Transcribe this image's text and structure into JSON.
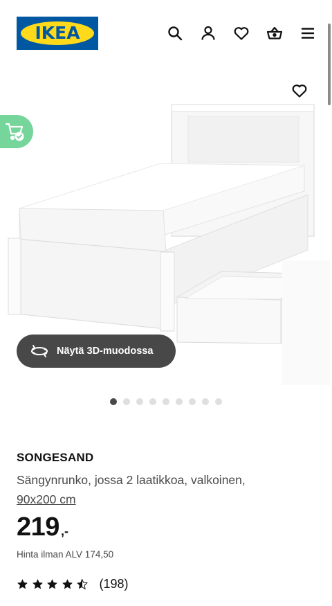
{
  "header": {
    "logo_text": "IKEA",
    "icons": [
      "search-icon",
      "user-icon",
      "heart-icon",
      "basket-icon",
      "menu-icon"
    ]
  },
  "gallery": {
    "view3d_label": "Näytä 3D-muodossa",
    "slide_count": 9,
    "active_slide": 1
  },
  "product": {
    "brand": "SONGESAND",
    "description": "Sängynrunko, jossa 2 laatikkoa, valkoinen,",
    "size": "90x200 cm",
    "price": "219",
    "price_suffix": ",-",
    "vat_note": "Hinta ilman ALV 174,50",
    "rating": 4.5,
    "rating_count": "(198)"
  },
  "colors": {
    "ikea_blue": "#0058a3",
    "ikea_yellow": "#ffda1a",
    "badge_green": "#76d59a",
    "button_dark": "#484848"
  }
}
